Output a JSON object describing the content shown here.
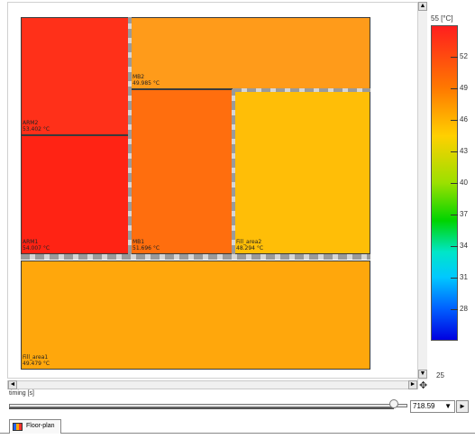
{
  "blocks": {
    "arm2": {
      "name": "ARM2",
      "temp": "53.402 °C",
      "color": "#ff3019"
    },
    "arm1": {
      "name": "ARM1",
      "temp": "54.007 °C",
      "color": "#ff2314"
    },
    "mb2": {
      "name": "MB2",
      "temp": "49.985 °C",
      "color": "#ff9b1a"
    },
    "mb1": {
      "name": "MB1",
      "temp": "51.696 °C",
      "color": "#ff6e0e"
    },
    "fill2": {
      "name": "Fill_area2",
      "temp": "48.294 °C",
      "color": "#ffbe07"
    },
    "fill1": {
      "name": "Fill_area1",
      "temp": "49.479 °C",
      "color": "#ffa70c"
    }
  },
  "legend": {
    "unit_label": "55 [°C]",
    "min_label": "25",
    "ticks": [
      "52",
      "49",
      "46",
      "43",
      "40",
      "37",
      "34",
      "31",
      "28"
    ]
  },
  "timing": {
    "label": "timing [s]",
    "value": "718.59",
    "position_fraction": 0.99
  },
  "tab": {
    "label": "Floor-plan"
  },
  "icons": {
    "scroll_up": "▲",
    "scroll_down": "▼",
    "scroll_left": "◄",
    "scroll_right": "►",
    "move": "✥",
    "dropdown": "▼",
    "next": "►"
  }
}
